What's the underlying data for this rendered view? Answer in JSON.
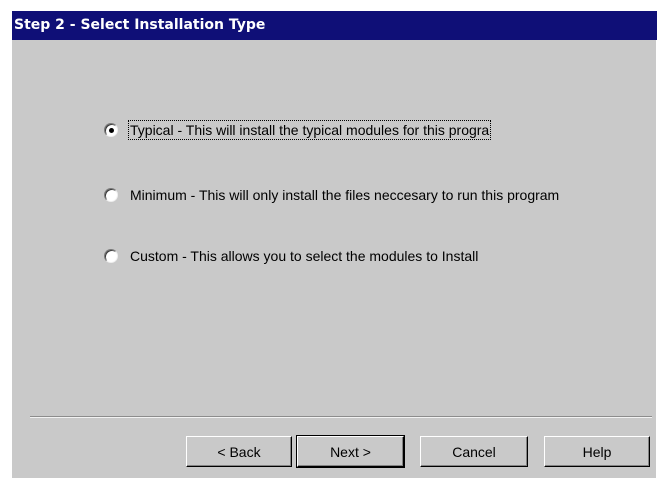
{
  "window": {
    "title": "Step 2 - Select Installation Type"
  },
  "options": [
    {
      "label": "Typical - This will install the typical modules for this progra",
      "selected": true
    },
    {
      "label": "Minimum - This will only install the files neccesary to run this program",
      "selected": false
    },
    {
      "label": "Custom - This allows you to select the modules to Install",
      "selected": false
    }
  ],
  "buttons": {
    "back": "< Back",
    "next": "Next >",
    "cancel": "Cancel",
    "help": "Help"
  },
  "colors": {
    "title_bar": "#0f0f77",
    "dialog_face": "#c9c9c9"
  },
  "icons": {
    "radio_selected": "radio-selected-icon",
    "radio_unselected": "radio-unselected-icon"
  }
}
